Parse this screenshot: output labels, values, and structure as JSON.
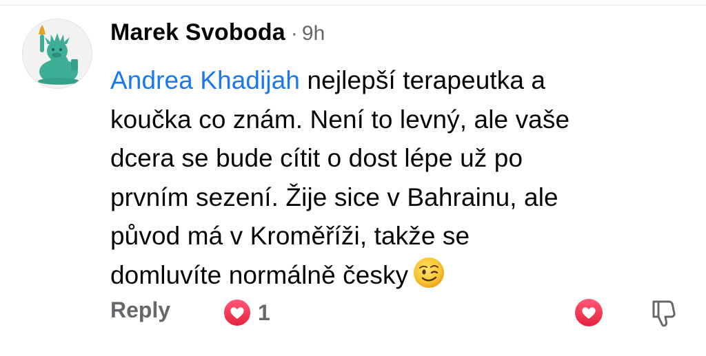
{
  "comment": {
    "author": "Marek Svoboda",
    "separator": "·",
    "time": "9h",
    "mention": "Andrea Khadijah",
    "lines": [
      " nejlepší terapeutka a",
      "koučka co znám. Není to levný, ale vaše",
      "dcera se bude cítit o dost lépe už po",
      "prvním sezení. Žije sice v Bahrainu, ale",
      "původ má v Kroměříži, takže se",
      "domluvíte normálně česky"
    ],
    "emoji": "winking-face"
  },
  "actions": {
    "reply_label": "Reply",
    "reaction_count": "1"
  },
  "colors": {
    "mention": "#1877f2",
    "secondary_text": "#65676b",
    "heart": "#f0284a",
    "avatar_figure": "#3fae97"
  },
  "icons": {
    "avatar": "statue-of-liberty-duck",
    "reaction": "heart-icon",
    "like": "heart-icon",
    "dislike": "thumbs-down-icon"
  }
}
